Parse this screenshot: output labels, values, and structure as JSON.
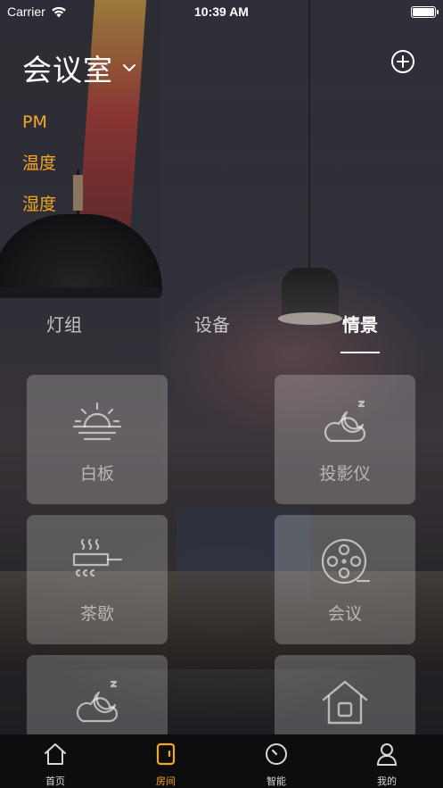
{
  "status_bar": {
    "carrier": "Carrier",
    "time": "10:39 AM"
  },
  "header": {
    "room_title": "会议室"
  },
  "readings": [
    "PM",
    "温度",
    "湿度"
  ],
  "tabs": [
    {
      "label": "灯组",
      "active": false
    },
    {
      "label": "设备",
      "active": false
    },
    {
      "label": "情景",
      "active": true
    }
  ],
  "scenes": [
    {
      "label": "白板",
      "icon": "sunrise-icon"
    },
    {
      "label": "投影仪",
      "icon": "night-cloud-icon"
    },
    {
      "label": "茶歇",
      "icon": "cooking-pot-icon"
    },
    {
      "label": "会议",
      "icon": "film-reel-icon"
    },
    {
      "label": "",
      "icon": "night-cloud-icon"
    },
    {
      "label": "",
      "icon": "home-icon"
    }
  ],
  "tabbar": [
    {
      "label": "首页",
      "icon": "home-icon",
      "active": false
    },
    {
      "label": "房间",
      "icon": "room-icon",
      "active": true
    },
    {
      "label": "智能",
      "icon": "clock-icon",
      "active": false
    },
    {
      "label": "我的",
      "icon": "person-icon",
      "active": false
    }
  ],
  "colors": {
    "accent": "#f5a623",
    "tabbar_bg": "#0d0d0f",
    "card_bg": "rgba(255,255,255,0.22)"
  }
}
